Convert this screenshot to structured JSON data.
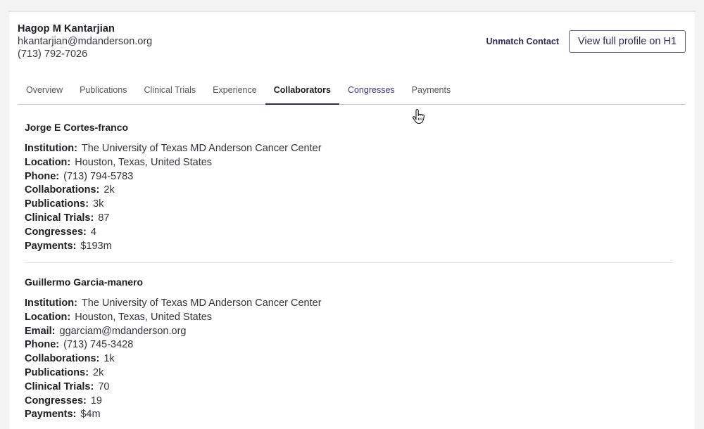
{
  "contact": {
    "name": "Hagop M Kantarjian",
    "email": "hkantarjian@mdanderson.org",
    "phone": "(713) 792-7026"
  },
  "actions": {
    "unmatch_label": "Unmatch Contact",
    "view_profile_label": "View full profile on H1"
  },
  "tabs": [
    {
      "label": "Overview"
    },
    {
      "label": "Publications"
    },
    {
      "label": "Clinical Trials"
    },
    {
      "label": "Experience"
    },
    {
      "label": "Collaborators"
    },
    {
      "label": "Congresses"
    },
    {
      "label": "Payments"
    }
  ],
  "active_tab": "Collaborators",
  "collaborators": [
    {
      "name": "Jorge E Cortes-franco",
      "fields": [
        {
          "label": "Institution:",
          "value": "The University of Texas MD Anderson Cancer Center"
        },
        {
          "label": "Location:",
          "value": "Houston, Texas, United States"
        },
        {
          "label": "Phone:",
          "value": "(713) 794-5783"
        },
        {
          "label": "Collaborations:",
          "value": "2k"
        },
        {
          "label": "Publications:",
          "value": "3k"
        },
        {
          "label": "Clinical Trials:",
          "value": "87"
        },
        {
          "label": "Congresses:",
          "value": "4"
        },
        {
          "label": "Payments:",
          "value": "$193m"
        }
      ]
    },
    {
      "name": "Guillermo Garcia-manero",
      "fields": [
        {
          "label": "Institution:",
          "value": "The University of Texas MD Anderson Cancer Center"
        },
        {
          "label": "Location:",
          "value": "Houston, Texas, United States"
        },
        {
          "label": "Email:",
          "value": "ggarciam@mdanderson.org"
        },
        {
          "label": "Phone:",
          "value": "(713) 745-3428"
        },
        {
          "label": "Collaborations:",
          "value": "1k"
        },
        {
          "label": "Publications:",
          "value": "2k"
        },
        {
          "label": "Clinical Trials:",
          "value": "70"
        },
        {
          "label": "Congresses:",
          "value": "19"
        },
        {
          "label": "Payments:",
          "value": "$4m"
        }
      ]
    }
  ],
  "colors": {
    "accent": "#2e2a55",
    "tab_hover": "#3a3680"
  }
}
